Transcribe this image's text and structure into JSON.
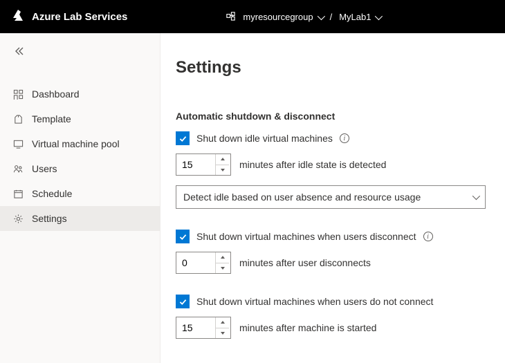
{
  "header": {
    "brand": "Azure Lab Services",
    "resource_group": "myresourcegroup",
    "lab": "MyLab1"
  },
  "sidebar": {
    "items": [
      {
        "label": "Dashboard"
      },
      {
        "label": "Template"
      },
      {
        "label": "Virtual machine pool"
      },
      {
        "label": "Users"
      },
      {
        "label": "Schedule"
      },
      {
        "label": "Settings"
      }
    ]
  },
  "page": {
    "title": "Settings",
    "section_heading": "Automatic shutdown & disconnect",
    "idle": {
      "checkbox_label": "Shut down idle virtual machines",
      "minutes": "15",
      "helper": "minutes after idle state is detected",
      "dropdown_selected": "Detect idle based on user absence and resource usage"
    },
    "disconnect": {
      "checkbox_label": "Shut down virtual machines when users disconnect",
      "minutes": "0",
      "helper": "minutes after user disconnects"
    },
    "noconnect": {
      "checkbox_label": "Shut down virtual machines when users do not connect",
      "minutes": "15",
      "helper": "minutes after machine is started"
    }
  }
}
